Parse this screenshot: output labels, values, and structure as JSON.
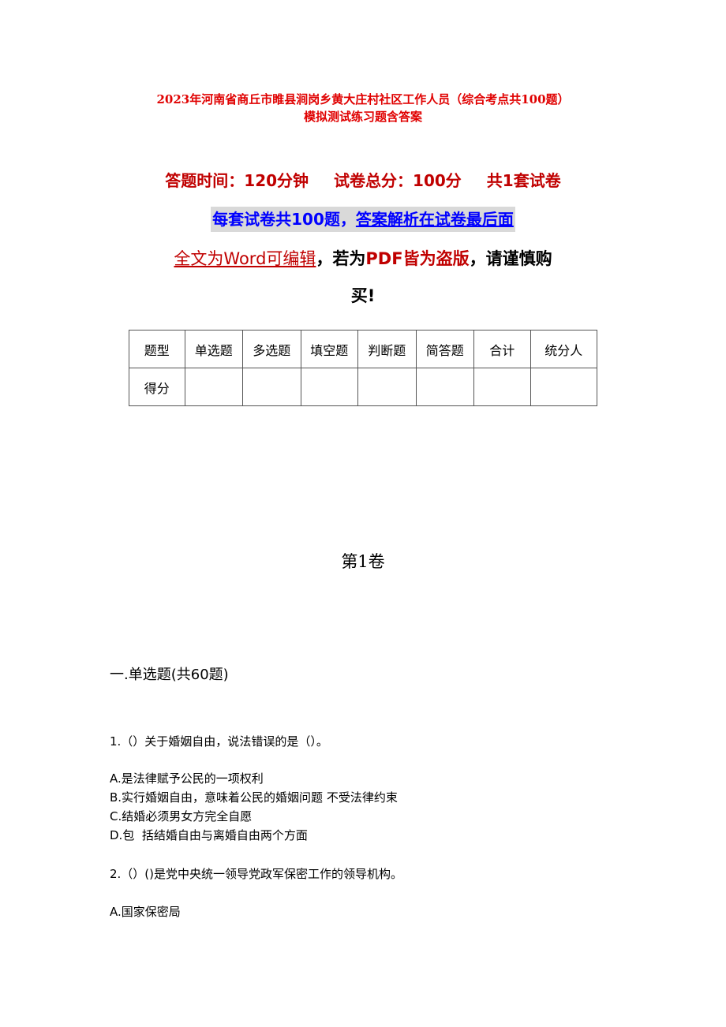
{
  "document": {
    "title_line1": "2023年河南省商丘市睢县涧岗乡黄大庄村社区工作人员（综合考点共100题）",
    "title_line2": "模拟测试练习题含答案",
    "exam_info": {
      "time": "答题时间：120分钟",
      "total_score": "试卷总分：100分",
      "sets": "共1套试卷"
    },
    "banner": {
      "part1": "每套试卷共100题，",
      "part2": "答案解析在试卷最后面"
    },
    "notice": {
      "part1": "全文为Word可编辑",
      "part2": "，若为",
      "part3": "PDF皆为盗版",
      "part4": "，请谨慎购",
      "part5": "买!"
    },
    "score_table": {
      "headers": [
        "题型",
        "单选题",
        "多选题",
        "填空题",
        "判断题",
        "简答题",
        "合计",
        "统分人"
      ],
      "row_label": "得分",
      "row_values": [
        "",
        "",
        "",
        "",
        "",
        "",
        ""
      ]
    },
    "volume_title": "第1卷",
    "section_title": "一.单选题(共60题)",
    "questions": [
      {
        "stem": "1.（）关于婚姻自由，说法错误的是（）。",
        "options": [
          "A.是法律赋予公民的一项权利",
          "B.实行婚姻自由，意味着公民的婚姻问题 不受法律约束",
          "C.结婚必须男女方完全自愿",
          "D.包  括结婚自由与离婚自由两个方面"
        ]
      },
      {
        "stem": "2.（）()是党中央统一领导党政军保密工作的领导机构。",
        "options": [
          "A.国家保密局"
        ]
      }
    ]
  }
}
